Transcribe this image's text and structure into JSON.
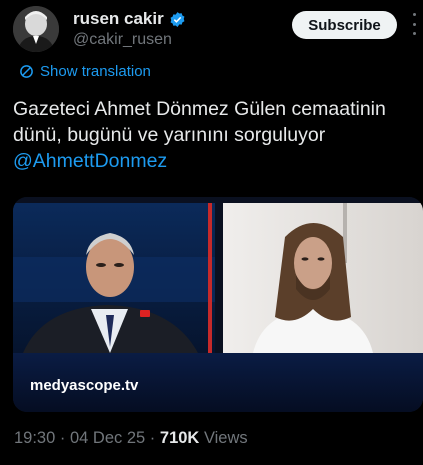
{
  "author": {
    "name": "rusen cakir",
    "handle": "@cakir_rusen"
  },
  "subscribe_label": "Subscribe",
  "translate_label": "Show translation",
  "tweet": {
    "text": "Gazeteci Ahmet Dönmez Gülen cemaatinin dünü, bugünü ve yarınını sorguluyor",
    "mention": "@AhmettDonmez"
  },
  "media": {
    "watermark": "medyascope.tv"
  },
  "meta": {
    "time": "19:30",
    "date": "04 Dec 25",
    "views_count": "710K",
    "views_label": "Views"
  },
  "colors": {
    "accent": "#1d9bf0",
    "background": "#000000",
    "secondary_text": "#71767b"
  },
  "icons": {
    "verified": "verified-badge-icon",
    "translate": "globe-translate-icon",
    "more": "more-vertical-icon"
  }
}
